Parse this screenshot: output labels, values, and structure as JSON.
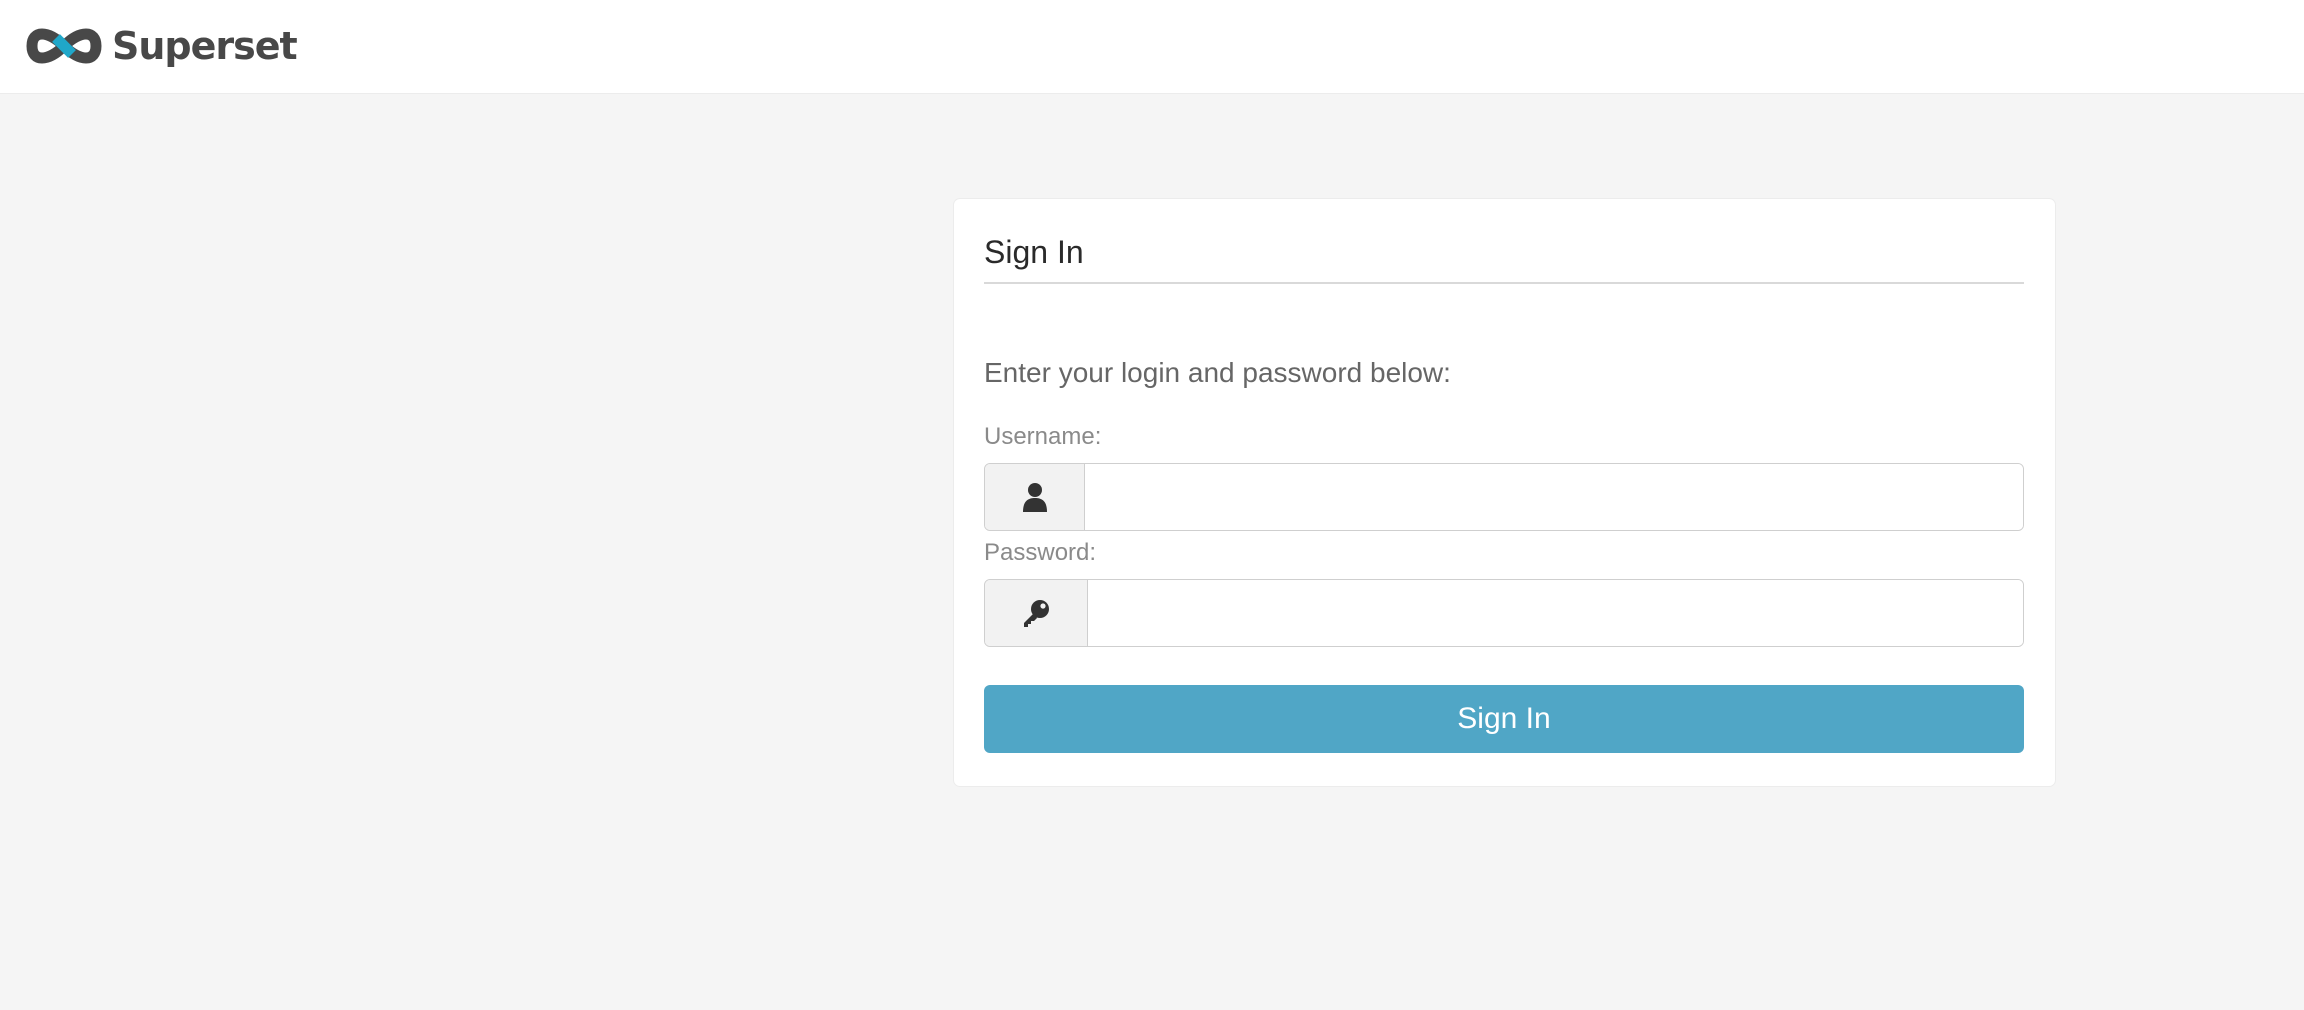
{
  "brand": {
    "name": "Superset",
    "colors": {
      "logo_dark": "#484848",
      "logo_accent": "#20a7c9"
    }
  },
  "login": {
    "title": "Sign In",
    "intro": "Enter your login and password below:",
    "username": {
      "label": "Username:",
      "value": "",
      "placeholder": "",
      "icon": "user-icon"
    },
    "password": {
      "label": "Password:",
      "value": "",
      "placeholder": "",
      "icon": "key-icon"
    },
    "submit_label": "Sign In",
    "colors": {
      "submit_bg": "#50a6c6",
      "submit_text": "#ffffff"
    }
  }
}
